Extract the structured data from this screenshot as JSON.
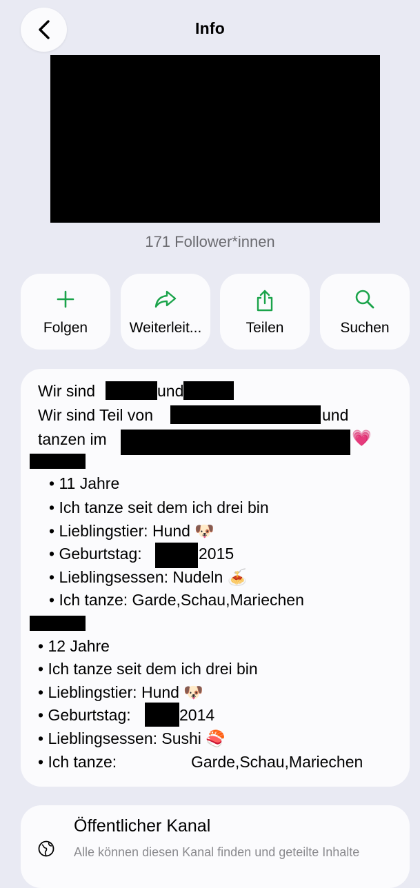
{
  "header": {
    "title": "Info",
    "back_icon": "chevron-left-icon"
  },
  "channel_info": {
    "followers": "171 Follower*innen"
  },
  "actions": [
    {
      "label": "Folgen",
      "icon": "plus-icon"
    },
    {
      "label": "Weiterleit...",
      "icon": "forward-arrow-icon"
    },
    {
      "label": "Teilen",
      "icon": "share-icon"
    },
    {
      "label": "Suchen",
      "icon": "search-icon"
    }
  ],
  "description": {
    "line1_a": "Wir sind",
    "line1_b": "und",
    "line2_a": "Wir sind Teil von",
    "line2_b": "und",
    "line3_a": "tanzen im",
    "line3_emoji": "💗",
    "person1": [
      "• 11 Jahre",
      "• Ich tanze seit dem ich drei bin",
      "• Lieblingstier: Hund 🐶",
      "• Geburtstag:",
      "• Lieblingsessen: Nudeln 🍝",
      "• Ich tanze: Garde,Schau,Mariechen"
    ],
    "person1_birth_year": "2015",
    "person2": [
      "• 12 Jahre",
      "• Ich tanze seit dem ich drei bin",
      "• Lieblingstier: Hund 🐶",
      "• Geburtstag:",
      "• Lieblingsessen: Sushi 🍣",
      "• Ich tanze:"
    ],
    "person2_birth_year": "2014",
    "person2_dance_styles": "Garde,Schau,Mariechen"
  },
  "channel_type": {
    "title": "Öffentlicher Kanal",
    "subtitle": "Alle können diesen Kanal finden und geteilte Inhalte",
    "icon": "public-globe-icon"
  },
  "colors": {
    "accent": "#1aa34a",
    "background": "#e9eaf3",
    "card": "#fbfbfd"
  }
}
